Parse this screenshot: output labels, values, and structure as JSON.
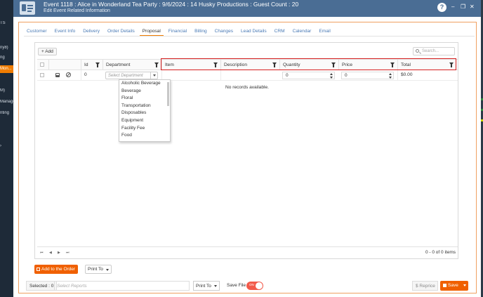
{
  "header": {
    "title": "Event 1118 : Alice in Wonderland Tea Party : 9/6/2024 : 14 Husky Productions : Guest Count : 20",
    "subtitle": "Edit Event Related Information",
    "help_label": "?",
    "minimize_label": "–",
    "maximize_label": "❐",
    "close_label": "✕"
  },
  "background_sidebar": {
    "items": [
      "TS",
      "ny8)",
      "ng",
      "Mon...",
      "M)",
      "Manage",
      "nting",
      "›"
    ]
  },
  "tabs": [
    "Customer",
    "Event Info",
    "Delivery",
    "Order Details",
    "Proposal",
    "Financial",
    "Billing",
    "Changes",
    "Lead Details",
    "CRM",
    "Calendar",
    "Email"
  ],
  "active_tab": "Proposal",
  "grid": {
    "add_label": "+ Add",
    "search_placeholder": "Search...",
    "columns": [
      "Id",
      "Department",
      "Item",
      "Description",
      "Quantity",
      "Price",
      "Total"
    ],
    "new_row": {
      "id": "0",
      "department_placeholder": "Select Department",
      "quantity": "0",
      "price": "0",
      "total": "$0.00"
    },
    "empty_text": "No records available.",
    "pager_info": "0 - 0 of 0 items",
    "pager_icons": [
      "first-page-icon",
      "prev-page-icon",
      "next-page-icon",
      "last-page-icon"
    ],
    "pager_glyphs": [
      "⏮",
      "◀",
      "▶",
      "⏭"
    ]
  },
  "department_options": [
    "Alcoholic Beverage",
    "Beverage",
    "Floral",
    "Transportation",
    "Disposables",
    "Equipment",
    "Facility Fee",
    "Food"
  ],
  "actions": {
    "add_to_order": "Add to the Order",
    "print_to": "Print To",
    "selected": "Selected : 0",
    "select_reports_placeholder": "Select Reports",
    "print_to_2": "Print To",
    "save_file": "Save File",
    "toggle_label": "ON",
    "reprice": "$ Reprice",
    "save": "Save"
  },
  "colors": {
    "header_bg": "#4a6d94",
    "accent": "#f06000",
    "highlight_border": "#d62020",
    "link": "#4a7ab5"
  }
}
